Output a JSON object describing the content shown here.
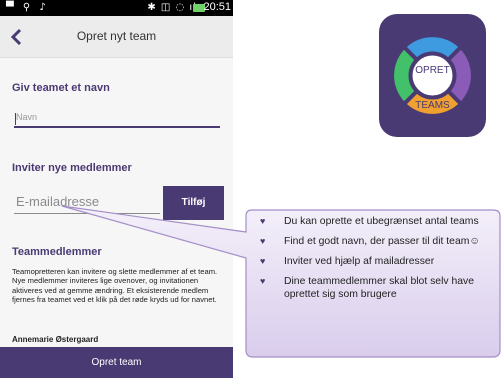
{
  "status_bar": {
    "left_icons": "▀ ⚲ ♪",
    "right_icons": "✱ ◫ ◌ ıl",
    "time": "20:51"
  },
  "app_bar": {
    "back_icon": "chevron-left-icon",
    "title": "Opret nyt team"
  },
  "name_section": {
    "title": "Giv teamet et navn",
    "placeholder": "Navn"
  },
  "invite_section": {
    "title": "Inviter nye medlemmer",
    "placeholder": "E-mailadresse",
    "add_button": "Tilføj"
  },
  "members_section": {
    "title": "Teammedlemmer",
    "description": "Teamopretteren kan invitere og slette medlemmer af et team. Nye medlemmer inviteres lige ovenover, og invitationen aktiveres ved at gemme ændring. Et eksisterende medlem fjernes fra teamet ved et klik på det røde kryds ud for navnet.",
    "member": "Annemarie Østergaard"
  },
  "footer": {
    "button": "Opret team"
  },
  "app_icon": {
    "line1": "OPRET",
    "line2": "TEAMS",
    "colors": {
      "background": "#4a3a73",
      "blue": "#3f9be0",
      "green": "#43c06a",
      "orange": "#f0a030",
      "purple": "#8b5bb8"
    }
  },
  "callout": {
    "items": [
      "Du kan oprette et ubegrænset antal teams",
      "Find et godt navn, der passer til dit team☺",
      "Inviter ved hjælp af mailadresser",
      "Dine teammedlemmer skal blot selv have oprettet sig som brugere"
    ]
  },
  "colors": {
    "accent": "#4a3a73",
    "callout_fill": "#e6def2"
  }
}
